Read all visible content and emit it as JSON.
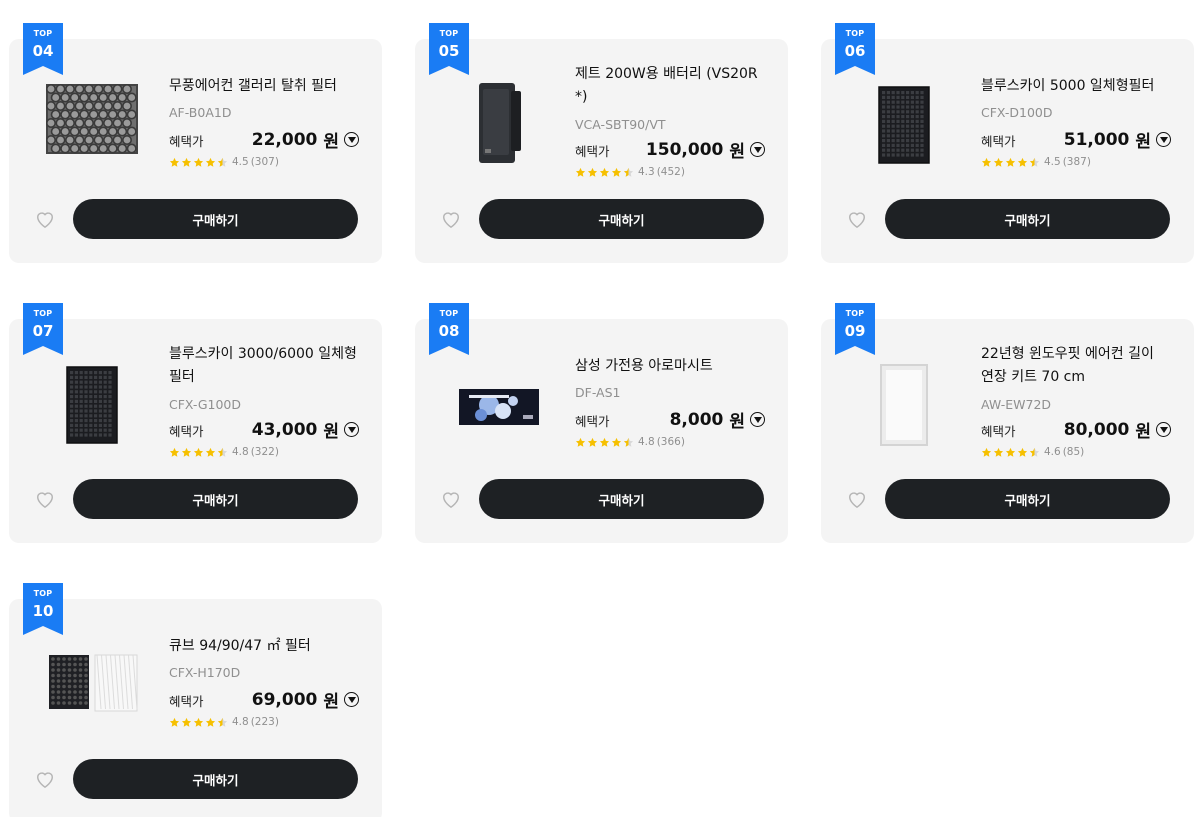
{
  "accent_color": "#1a7cf4",
  "button_color": "#1e2124",
  "star_color": "#f6c000",
  "products": [
    {
      "top_label": "TOP",
      "rank": "04",
      "name": "무풍에어컨 갤러리 탈취 필터",
      "model": "AF-B0A1D",
      "price_label": "혜택가",
      "price": "22,000",
      "currency": "원",
      "rating": "4.5",
      "reviews": "(307)",
      "buy_label": "구매하기",
      "thumbnail": "honeycomb-filter-image"
    },
    {
      "top_label": "TOP",
      "rank": "05",
      "name": "제트 200W용 배터리 (VS20R *)",
      "model": "VCA-SBT90/VT",
      "price_label": "혜택가",
      "price": "150,000",
      "currency": "원",
      "rating": "4.3",
      "reviews": "(452)",
      "buy_label": "구매하기",
      "thumbnail": "battery-image"
    },
    {
      "top_label": "TOP",
      "rank": "06",
      "name": "블루스카이 5000 일체형필터",
      "model": "CFX-D100D",
      "price_label": "혜택가",
      "price": "51,000",
      "currency": "원",
      "rating": "4.5",
      "reviews": "(387)",
      "buy_label": "구매하기",
      "thumbnail": "black-filter-image"
    },
    {
      "top_label": "TOP",
      "rank": "07",
      "name": "블루스카이 3000/6000 일체형 필터",
      "model": "CFX-G100D",
      "price_label": "혜택가",
      "price": "43,000",
      "currency": "원",
      "rating": "4.8",
      "reviews": "(322)",
      "buy_label": "구매하기",
      "thumbnail": "black-filter-image"
    },
    {
      "top_label": "TOP",
      "rank": "08",
      "name": "삼성 가전용 아로마시트",
      "model": "DF-AS1",
      "price_label": "혜택가",
      "price": "8,000",
      "currency": "원",
      "rating": "4.8",
      "reviews": "(366)",
      "buy_label": "구매하기",
      "thumbnail": "aroma-sheet-image"
    },
    {
      "top_label": "TOP",
      "rank": "09",
      "name": "22년형 윈도우핏 에어컨 길이 연장 키트 70 cm",
      "model": "AW-EW72D",
      "price_label": "혜택가",
      "price": "80,000",
      "currency": "원",
      "rating": "4.6",
      "reviews": "(85)",
      "buy_label": "구매하기",
      "thumbnail": "white-panel-image"
    },
    {
      "top_label": "TOP",
      "rank": "10",
      "name": "큐브 94/90/47 ㎡ 필터",
      "model": "CFX-H170D",
      "price_label": "혜택가",
      "price": "69,000",
      "currency": "원",
      "rating": "4.8",
      "reviews": "(223)",
      "buy_label": "구매하기",
      "thumbnail": "cube-filter-pair-image"
    }
  ]
}
